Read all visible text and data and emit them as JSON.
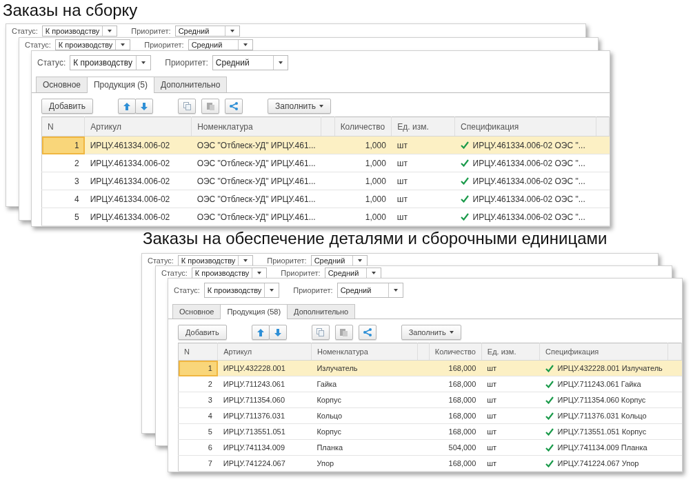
{
  "sections": [
    {
      "title": "Заказы на сборку",
      "back_windows": [
        {
          "status_label": "Статус:",
          "status": "К производству",
          "priority_label": "Приоритет:",
          "priority": "Средний"
        },
        {
          "status_label": "Статус:",
          "status": "К производству",
          "priority_label": "Приоритет:",
          "priority": "Средний"
        }
      ],
      "window": {
        "status_label": "Статус:",
        "status": "К производству",
        "priority_label": "Приоритет:",
        "priority": "Средний",
        "tabs": [
          {
            "label": "Основное",
            "selected": false
          },
          {
            "label": "Продукция (5)",
            "selected": true
          },
          {
            "label": "Дополнительно",
            "selected": false
          }
        ],
        "toolbar": {
          "add": "Добавить",
          "fill": "Заполнить"
        },
        "columns": [
          "N",
          "Артикул",
          "Номенклатура",
          "Количество",
          "Ед. изм.",
          "Спецификация"
        ],
        "rows": [
          {
            "n": "1",
            "article": "ИРЦУ.461334.006-02",
            "name": "ОЭС \"Отблеск-УД\" ИРЦУ.461...",
            "qty": "1,000",
            "unit": "шт",
            "spec": "ИРЦУ.461334.006-02 ОЭС \"...",
            "spec_ok": true,
            "selected": true
          },
          {
            "n": "2",
            "article": "ИРЦУ.461334.006-02",
            "name": "ОЭС \"Отблеск-УД\" ИРЦУ.461...",
            "qty": "1,000",
            "unit": "шт",
            "spec": "ИРЦУ.461334.006-02 ОЭС \"...",
            "spec_ok": true,
            "selected": false
          },
          {
            "n": "3",
            "article": "ИРЦУ.461334.006-02",
            "name": "ОЭС \"Отблеск-УД\" ИРЦУ.461...",
            "qty": "1,000",
            "unit": "шт",
            "spec": "ИРЦУ.461334.006-02 ОЭС \"...",
            "spec_ok": true,
            "selected": false
          },
          {
            "n": "4",
            "article": "ИРЦУ.461334.006-02",
            "name": "ОЭС \"Отблеск-УД\" ИРЦУ.461...",
            "qty": "1,000",
            "unit": "шт",
            "spec": "ИРЦУ.461334.006-02 ОЭС \"...",
            "spec_ok": true,
            "selected": false
          },
          {
            "n": "5",
            "article": "ИРЦУ.461334.006-02",
            "name": "ОЭС \"Отблеск-УД\" ИРЦУ.461...",
            "qty": "1,000",
            "unit": "шт",
            "spec": "ИРЦУ.461334.006-02 ОЭС \"...",
            "spec_ok": true,
            "selected": false
          }
        ]
      }
    },
    {
      "title": "Заказы на обеспечение деталями и сборочными единицами",
      "back_windows": [
        {
          "status_label": "Статус:",
          "status": "К производству",
          "priority_label": "Приоритет:",
          "priority": "Средний"
        },
        {
          "status_label": "Статус:",
          "status": "К производству",
          "priority_label": "Приоритет:",
          "priority": "Средний"
        }
      ],
      "window": {
        "status_label": "Статус:",
        "status": "К производству",
        "priority_label": "Приоритет:",
        "priority": "Средний",
        "tabs": [
          {
            "label": "Основное",
            "selected": false
          },
          {
            "label": "Продукция (58)",
            "selected": true
          },
          {
            "label": "Дополнительно",
            "selected": false
          }
        ],
        "toolbar": {
          "add": "Добавить",
          "fill": "Заполнить"
        },
        "columns": [
          "N",
          "Артикул",
          "Номенклатура",
          "Количество",
          "Ед. изм.",
          "Спецификация"
        ],
        "rows": [
          {
            "n": "1",
            "article": "ИРЦУ.432228.001",
            "name": "Излучатель",
            "qty": "168,000",
            "unit": "шт",
            "spec": "ИРЦУ.432228.001 Излучатель",
            "spec_ok": true,
            "selected": true
          },
          {
            "n": "2",
            "article": "ИРЦУ.711243.061",
            "name": "Гайка",
            "qty": "168,000",
            "unit": "шт",
            "spec": "ИРЦУ.711243.061 Гайка",
            "spec_ok": true,
            "selected": false
          },
          {
            "n": "3",
            "article": "ИРЦУ.711354.060",
            "name": "Корпус",
            "qty": "168,000",
            "unit": "шт",
            "spec": "ИРЦУ.711354.060 Корпус",
            "spec_ok": true,
            "selected": false
          },
          {
            "n": "4",
            "article": "ИРЦУ.711376.031",
            "name": "Кольцо",
            "qty": "168,000",
            "unit": "шт",
            "spec": "ИРЦУ.711376.031 Кольцо",
            "spec_ok": true,
            "selected": false
          },
          {
            "n": "5",
            "article": "ИРЦУ.713551.051",
            "name": "Корпус",
            "qty": "168,000",
            "unit": "шт",
            "spec": "ИРЦУ.713551.051 Корпус",
            "spec_ok": true,
            "selected": false
          },
          {
            "n": "6",
            "article": "ИРЦУ.741134.009",
            "name": "Планка",
            "qty": "504,000",
            "unit": "шт",
            "spec": "ИРЦУ.741134.009 Планка",
            "spec_ok": true,
            "selected": false
          },
          {
            "n": "7",
            "article": "ИРЦУ.741224.067",
            "name": "Упор",
            "qty": "168,000",
            "unit": "шт",
            "spec": "ИРЦУ.741224.067 Упор",
            "spec_ok": true,
            "selected": false
          }
        ]
      }
    }
  ]
}
